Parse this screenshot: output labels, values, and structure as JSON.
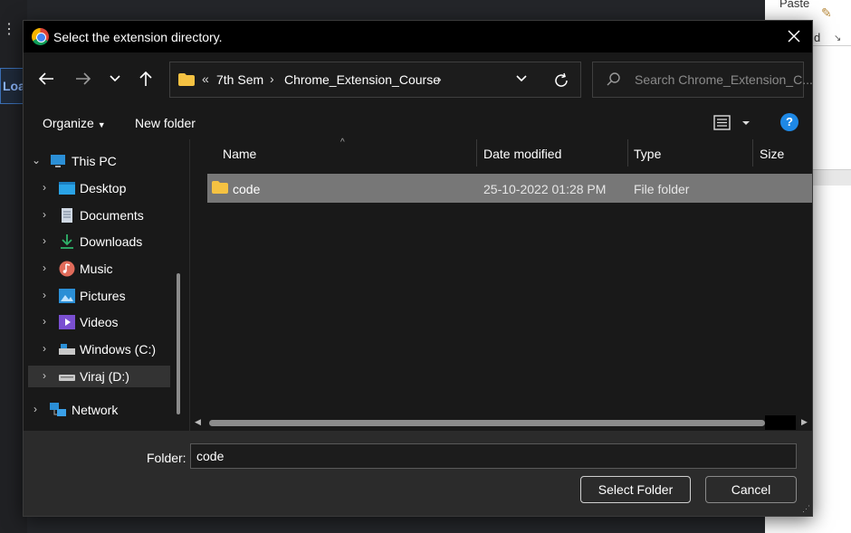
{
  "background_app": {
    "left_label": "Loa",
    "ribbon_paste": "Paste",
    "ribbon_fragment": "d"
  },
  "dialog": {
    "title": "Select the extension directory.",
    "nav": {
      "back_icon": "arrow-left-icon",
      "forward_icon": "arrow-right-icon",
      "recent_icon": "chevron-down-icon",
      "up_icon": "arrow-up-icon"
    },
    "address": {
      "overflow": "«",
      "segments": [
        "7th Sem",
        "Chrome_Extension_Course"
      ],
      "separator": "›"
    },
    "search": {
      "placeholder": "Search Chrome_Extension_C..."
    },
    "commands": {
      "organize": "Organize",
      "new_folder": "New folder"
    },
    "sidebar": {
      "items": [
        {
          "label": "This PC",
          "icon": "computer-icon",
          "expanded": true
        },
        {
          "label": "Desktop",
          "icon": "desktop-icon"
        },
        {
          "label": "Documents",
          "icon": "documents-icon"
        },
        {
          "label": "Downloads",
          "icon": "downloads-icon"
        },
        {
          "label": "Music",
          "icon": "music-icon"
        },
        {
          "label": "Pictures",
          "icon": "pictures-icon"
        },
        {
          "label": "Videos",
          "icon": "videos-icon"
        },
        {
          "label": "Windows (C:)",
          "icon": "drive-c-icon"
        },
        {
          "label": "Viraj (D:)",
          "icon": "drive-d-icon",
          "selected": true
        },
        {
          "label": "Network",
          "icon": "network-icon"
        }
      ]
    },
    "columns": {
      "name": "Name",
      "date": "Date modified",
      "type": "Type",
      "size": "Size"
    },
    "files": [
      {
        "name": "code",
        "date": "25-10-2022 01:28 PM",
        "type": "File folder",
        "selected": true
      }
    ],
    "footer": {
      "folder_label": "Folder:",
      "folder_value": "code",
      "select_button": "Select Folder",
      "cancel_button": "Cancel"
    },
    "colors": {
      "accent": "#1e88e5",
      "selected_row": "#777777",
      "folder": "#f5c242"
    }
  }
}
